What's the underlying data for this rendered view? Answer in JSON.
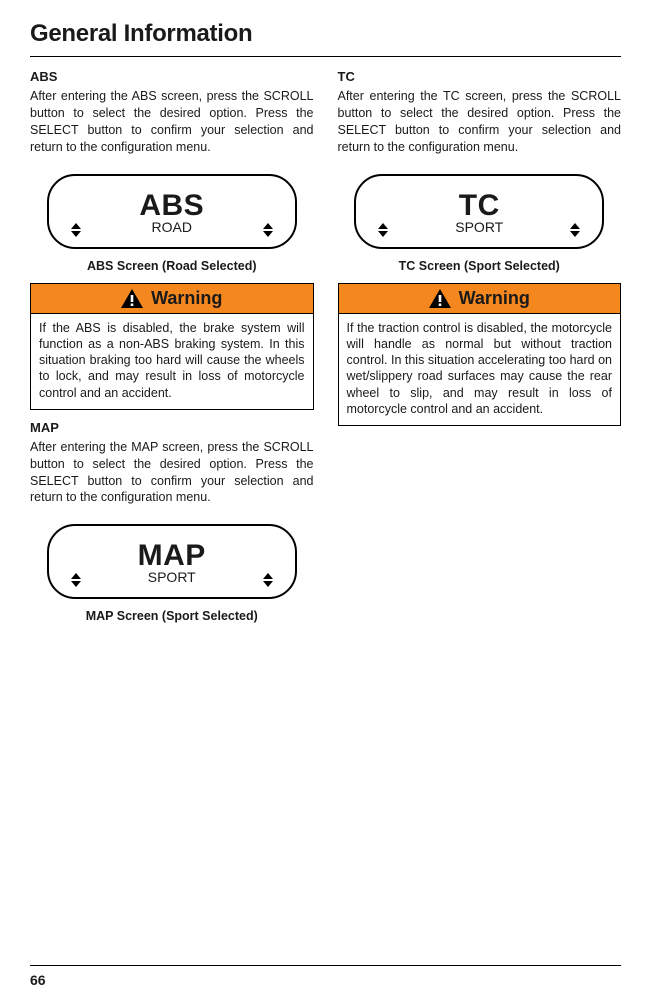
{
  "pageTitle": "General Information",
  "pageNumber": "66",
  "left": {
    "abs": {
      "heading": "ABS",
      "para": "After entering the ABS screen, press the SCROLL button to select the desired option. Press the SELECT button to confirm your selection and return to the configuration menu.",
      "screenTitle": "ABS",
      "screenSub": "ROAD",
      "caption": "ABS Screen (Road Selected)",
      "warningLabel": "Warning",
      "warningBody": "If the ABS is disabled, the brake system will function as a non-ABS braking system. In this situation braking too hard will cause the wheels to lock, and may result in loss of motorcycle control and an accident."
    },
    "map": {
      "heading": "MAP",
      "para": "After entering the MAP screen, press the SCROLL button to select the desired option. Press the SELECT button to confirm your selection and return to the configuration menu.",
      "screenTitle": "MAP",
      "screenSub": "SPORT",
      "caption": "MAP Screen (Sport Selected)"
    }
  },
  "right": {
    "tc": {
      "heading": "TC",
      "para": "After entering the TC screen, press the SCROLL button to select the desired option. Press the SELECT button to confirm your selection and return to the configuration menu.",
      "screenTitle": "TC",
      "screenSub": "SPORT",
      "caption": "TC Screen (Sport Selected)",
      "warningLabel": "Warning",
      "warningBody": "If the traction control is disabled, the motorcycle will handle as normal but without traction control. In this situation accelerating too hard on wet/slippery road surfaces may cause the rear wheel to slip, and may result in loss of motorcycle control and an accident."
    }
  }
}
